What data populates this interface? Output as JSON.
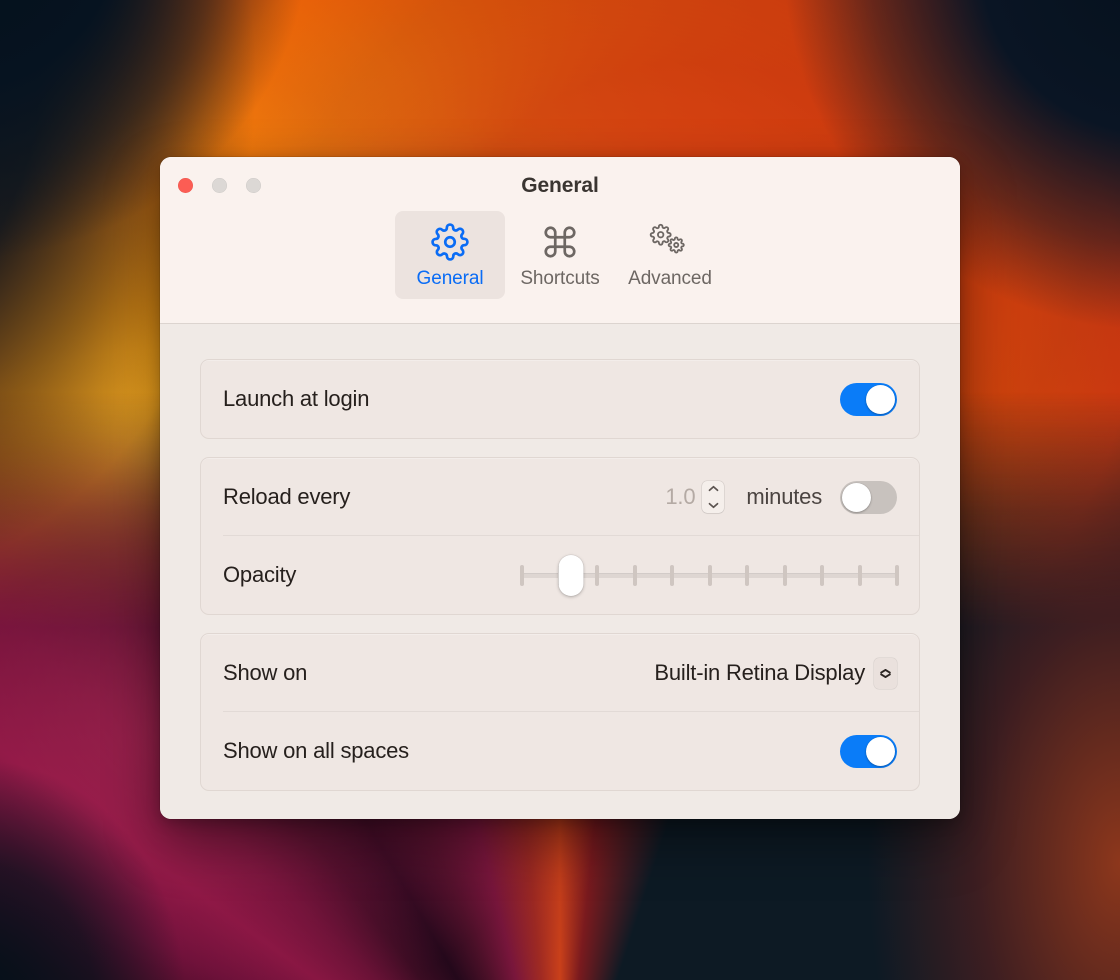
{
  "window": {
    "title": "General",
    "traffic_lights": [
      {
        "name": "close",
        "color": "#fc5d54"
      },
      {
        "name": "minimize",
        "color": "#dcd8d5"
      },
      {
        "name": "zoom",
        "color": "#dcd8d5"
      }
    ]
  },
  "tabs": [
    {
      "id": "general",
      "label": "General",
      "icon": "gear-icon",
      "selected": true
    },
    {
      "id": "shortcuts",
      "label": "Shortcuts",
      "icon": "command-key-icon",
      "selected": false
    },
    {
      "id": "advanced",
      "label": "Advanced",
      "icon": "double-gear-icon",
      "selected": false
    }
  ],
  "settings": {
    "launch_at_login": {
      "label": "Launch at login",
      "toggle_state": "on"
    },
    "reload_every": {
      "label": "Reload every",
      "value": "1.0",
      "unit": "minutes",
      "toggle_state": "off",
      "stepper_icon": "stepper-up-down-icon"
    },
    "opacity": {
      "label": "Opacity",
      "value_percent": 13,
      "tick_count": 11,
      "min": 0,
      "max": 100
    },
    "show_on": {
      "label": "Show on",
      "selected_option": "Built-in Retina Display",
      "chevron_icon": "chevron-up-down-icon"
    },
    "show_on_all_spaces": {
      "label": "Show on all spaces",
      "toggle_state": "on"
    }
  },
  "colors": {
    "accent_blue": "#0a7cf8",
    "tab_selected_text": "#0a6cf5",
    "window_bg": "#f0eae6",
    "toolbar_bg": "#faf2ee",
    "group_bg": "#efe7e3",
    "label_text": "#26201d",
    "muted_text": "#b4aaa4"
  }
}
